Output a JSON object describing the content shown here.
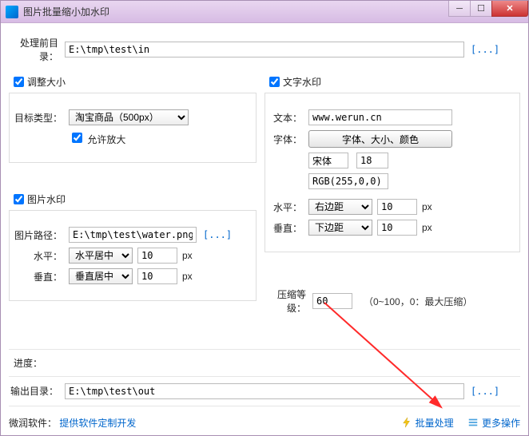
{
  "title": "图片批量缩小加水印",
  "input_dir": {
    "label": "处理前目录：",
    "value": "E:\\tmp\\test\\in",
    "browse": "[...]"
  },
  "resize": {
    "check_label": "调整大小",
    "checked": true,
    "type_label": "目标类型：",
    "type_value": "淘宝商品（500px）",
    "allow_enlarge_label": "允许放大",
    "allow_enlarge_checked": true
  },
  "image_wm": {
    "check_label": "图片水印",
    "checked": true,
    "path_label": "图片路径：",
    "path_value": "E:\\tmp\\test\\water.png",
    "browse": "[...]",
    "h_label": "水平：",
    "h_value": "水平居中",
    "h_num": "10",
    "h_unit": "px",
    "v_label": "垂直：",
    "v_value": "垂直居中",
    "v_num": "10",
    "v_unit": "px"
  },
  "text_wm": {
    "check_label": "文字水印",
    "checked": true,
    "text_label": "文本：",
    "text_value": "www.werun.cn",
    "font_label": "字体：",
    "font_button": "字体、大小、颜色",
    "font_name": "宋体",
    "font_size": "18",
    "font_color": "RGB(255,0,0)",
    "h_label": "水平：",
    "h_value": "右边距",
    "h_num": "10",
    "h_unit": "px",
    "v_label": "垂直：",
    "v_value": "下边距",
    "v_num": "10",
    "v_unit": "px"
  },
  "compress": {
    "label": "压缩等级：",
    "value": "60",
    "hint": "（0~100，0：最大压缩）"
  },
  "progress_label": "进度：",
  "output_dir": {
    "label": "输出目录：",
    "value": "E:\\tmp\\test\\out",
    "browse": "[...]"
  },
  "footer": {
    "company": "微润软件：",
    "slogan": "提供软件定制开发",
    "batch": "批量处理",
    "more": "更多操作"
  }
}
